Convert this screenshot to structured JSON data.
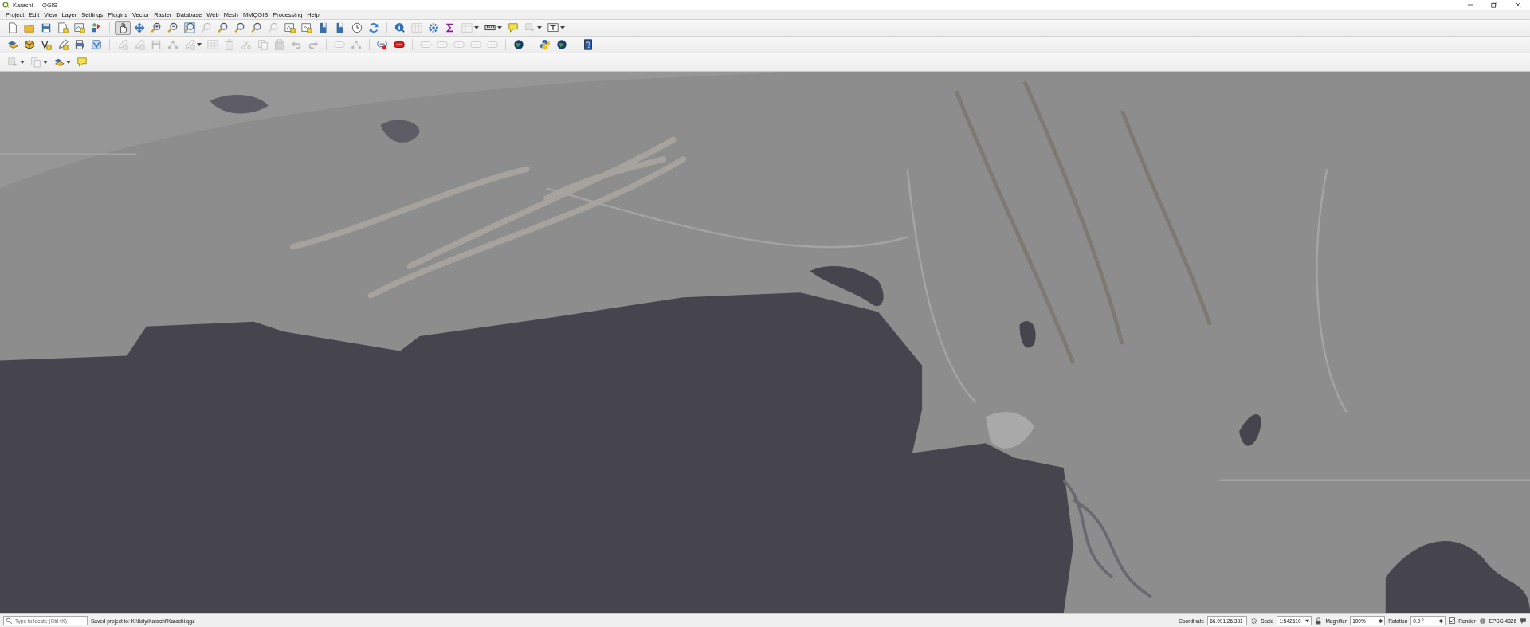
{
  "window": {
    "title": "Karachi — QGIS"
  },
  "menu": [
    "Project",
    "Edit",
    "View",
    "Layer",
    "Settings",
    "Plugins",
    "Vector",
    "Raster",
    "Database",
    "Web",
    "Mesh",
    "MMQGIS",
    "Processing",
    "Help"
  ],
  "toolbars": [
    {
      "groups": [
        [
          {
            "kind": "page",
            "disabled": false,
            "dropdown": false,
            "selected": false
          },
          {
            "kind": "folder",
            "disabled": false,
            "dropdown": false,
            "selected": false
          },
          {
            "kind": "floppy",
            "disabled": false,
            "dropdown": false,
            "selected": false
          },
          {
            "kind": "document",
            "disabled": false,
            "dropdown": false,
            "selected": false
          },
          {
            "kind": "map",
            "disabled": false,
            "dropdown": false,
            "selected": false
          },
          {
            "kind": "palette",
            "disabled": false,
            "dropdown": false,
            "selected": false
          }
        ],
        [
          {
            "kind": "hand",
            "disabled": false,
            "dropdown": false,
            "selected": true
          },
          {
            "kind": "arrows",
            "disabled": false,
            "dropdown": false,
            "selected": false
          },
          {
            "kind": "zoom-in",
            "disabled": false,
            "dropdown": false,
            "selected": false
          },
          {
            "kind": "zoom-out",
            "disabled": false,
            "dropdown": false,
            "selected": false
          },
          {
            "kind": "extent",
            "disabled": false,
            "dropdown": false,
            "selected": false
          },
          {
            "kind": "magnifier",
            "disabled": true,
            "dropdown": false,
            "selected": false
          },
          {
            "kind": "magnifier",
            "disabled": false,
            "dropdown": false,
            "selected": false
          },
          {
            "kind": "magnifier",
            "disabled": false,
            "dropdown": false,
            "selected": false
          },
          {
            "kind": "magnifier",
            "disabled": false,
            "dropdown": false,
            "selected": false
          },
          {
            "kind": "magnifier",
            "disabled": true,
            "dropdown": false,
            "selected": false
          },
          {
            "kind": "map",
            "disabled": false,
            "dropdown": false,
            "selected": false
          },
          {
            "kind": "map",
            "disabled": false,
            "dropdown": false,
            "selected": false
          },
          {
            "kind": "bookmark",
            "disabled": false,
            "dropdown": false,
            "selected": false
          },
          {
            "kind": "bookmark",
            "disabled": false,
            "dropdown": false,
            "selected": false
          },
          {
            "kind": "clock",
            "disabled": false,
            "dropdown": false,
            "selected": false
          },
          {
            "kind": "refresh",
            "disabled": false,
            "dropdown": false,
            "selected": false
          }
        ],
        [
          {
            "kind": "info",
            "disabled": false,
            "dropdown": false,
            "selected": false
          },
          {
            "kind": "table",
            "disabled": true,
            "dropdown": false,
            "selected": false
          },
          {
            "kind": "gear",
            "disabled": false,
            "dropdown": false,
            "selected": false
          },
          {
            "kind": "sigma",
            "disabled": false,
            "dropdown": false,
            "selected": false
          },
          {
            "kind": "table",
            "disabled": true,
            "dropdown": true,
            "selected": false
          },
          {
            "kind": "ruler",
            "disabled": false,
            "dropdown": true,
            "selected": false
          },
          {
            "kind": "speech",
            "disabled": false,
            "dropdown": false,
            "selected": false
          },
          {
            "kind": "selection",
            "disabled": true,
            "dropdown": true,
            "selected": false
          },
          {
            "kind": "text-box",
            "disabled": false,
            "dropdown": true,
            "selected": false
          }
        ]
      ]
    },
    {
      "groups": [
        [
          {
            "kind": "layers",
            "disabled": false,
            "dropdown": false,
            "selected": false
          },
          {
            "kind": "cube",
            "disabled": false,
            "dropdown": false,
            "selected": false
          },
          {
            "kind": "vertex",
            "disabled": false,
            "dropdown": false,
            "selected": false
          },
          {
            "kind": "pencil",
            "disabled": false,
            "dropdown": false,
            "selected": false
          },
          {
            "kind": "printer",
            "disabled": false,
            "dropdown": false,
            "selected": false
          },
          {
            "kind": "layer-box",
            "disabled": false,
            "dropdown": false,
            "selected": false
          }
        ],
        [
          {
            "kind": "pencil",
            "disabled": true,
            "dropdown": false,
            "selected": false
          },
          {
            "kind": "pencil",
            "disabled": true,
            "dropdown": false,
            "selected": false
          },
          {
            "kind": "floppy",
            "disabled": true,
            "dropdown": false,
            "selected": false
          },
          {
            "kind": "nodes",
            "disabled": true,
            "dropdown": false,
            "selected": false
          },
          {
            "kind": "pencil",
            "disabled": true,
            "dropdown": true,
            "selected": false
          },
          {
            "kind": "table",
            "disabled": true,
            "dropdown": false,
            "selected": false
          },
          {
            "kind": "trash",
            "disabled": true,
            "dropdown": false,
            "selected": false
          },
          {
            "kind": "scissors",
            "disabled": true,
            "dropdown": false,
            "selected": false
          },
          {
            "kind": "copy",
            "disabled": true,
            "dropdown": false,
            "selected": false
          },
          {
            "kind": "paste",
            "disabled": true,
            "dropdown": false,
            "selected": false
          },
          {
            "kind": "undo",
            "disabled": true,
            "dropdown": false,
            "selected": false
          },
          {
            "kind": "redo",
            "disabled": true,
            "dropdown": false,
            "selected": false
          }
        ],
        [
          {
            "kind": "label",
            "disabled": true,
            "dropdown": false,
            "selected": false
          },
          {
            "kind": "nodes",
            "disabled": true,
            "dropdown": false,
            "selected": false
          }
        ],
        [
          {
            "kind": "label-pin",
            "disabled": false,
            "dropdown": false,
            "selected": false
          },
          {
            "kind": "label-red",
            "disabled": false,
            "dropdown": false,
            "selected": false
          }
        ],
        [
          {
            "kind": "label",
            "disabled": true,
            "dropdown": false,
            "selected": false
          },
          {
            "kind": "label",
            "disabled": true,
            "dropdown": false,
            "selected": false
          },
          {
            "kind": "label",
            "disabled": true,
            "dropdown": false,
            "selected": false
          },
          {
            "kind": "label",
            "disabled": true,
            "dropdown": false,
            "selected": false
          },
          {
            "kind": "label",
            "disabled": true,
            "dropdown": false,
            "selected": false
          }
        ],
        [
          {
            "kind": "globe",
            "disabled": false,
            "dropdown": false,
            "selected": false
          }
        ],
        [
          {
            "kind": "python",
            "disabled": false,
            "dropdown": false,
            "selected": false
          },
          {
            "kind": "globe",
            "disabled": false,
            "dropdown": false,
            "selected": false
          }
        ],
        [
          {
            "kind": "help",
            "disabled": false,
            "dropdown": false,
            "selected": false
          }
        ]
      ]
    },
    {
      "groups": [
        [
          {
            "kind": "selection",
            "disabled": true,
            "dropdown": true,
            "selected": false
          },
          {
            "kind": "copy",
            "disabled": true,
            "dropdown": true,
            "selected": false
          },
          {
            "kind": "layers",
            "disabled": false,
            "dropdown": true,
            "selected": false
          },
          {
            "kind": "speech",
            "disabled": false,
            "dropdown": false,
            "selected": false
          }
        ]
      ]
    }
  ],
  "status_bar": {
    "locator": {
      "placeholder": "Type to locate (Ctrl+K)"
    },
    "message": "Saved project to: K:\\Italy\\Karachi\\Karachi.qgz",
    "coordinate": {
      "label": "Coordinate",
      "value": "66.991,26.381"
    },
    "scale": {
      "label": "Scale",
      "value": "1:542610"
    },
    "magnifier": {
      "label": "Magnifier",
      "value": "100%"
    },
    "rotation": {
      "label": "Rotation",
      "value": "0.0 °"
    },
    "render": {
      "label": "Render",
      "checked": true
    },
    "crs": "EPSG:4326"
  }
}
